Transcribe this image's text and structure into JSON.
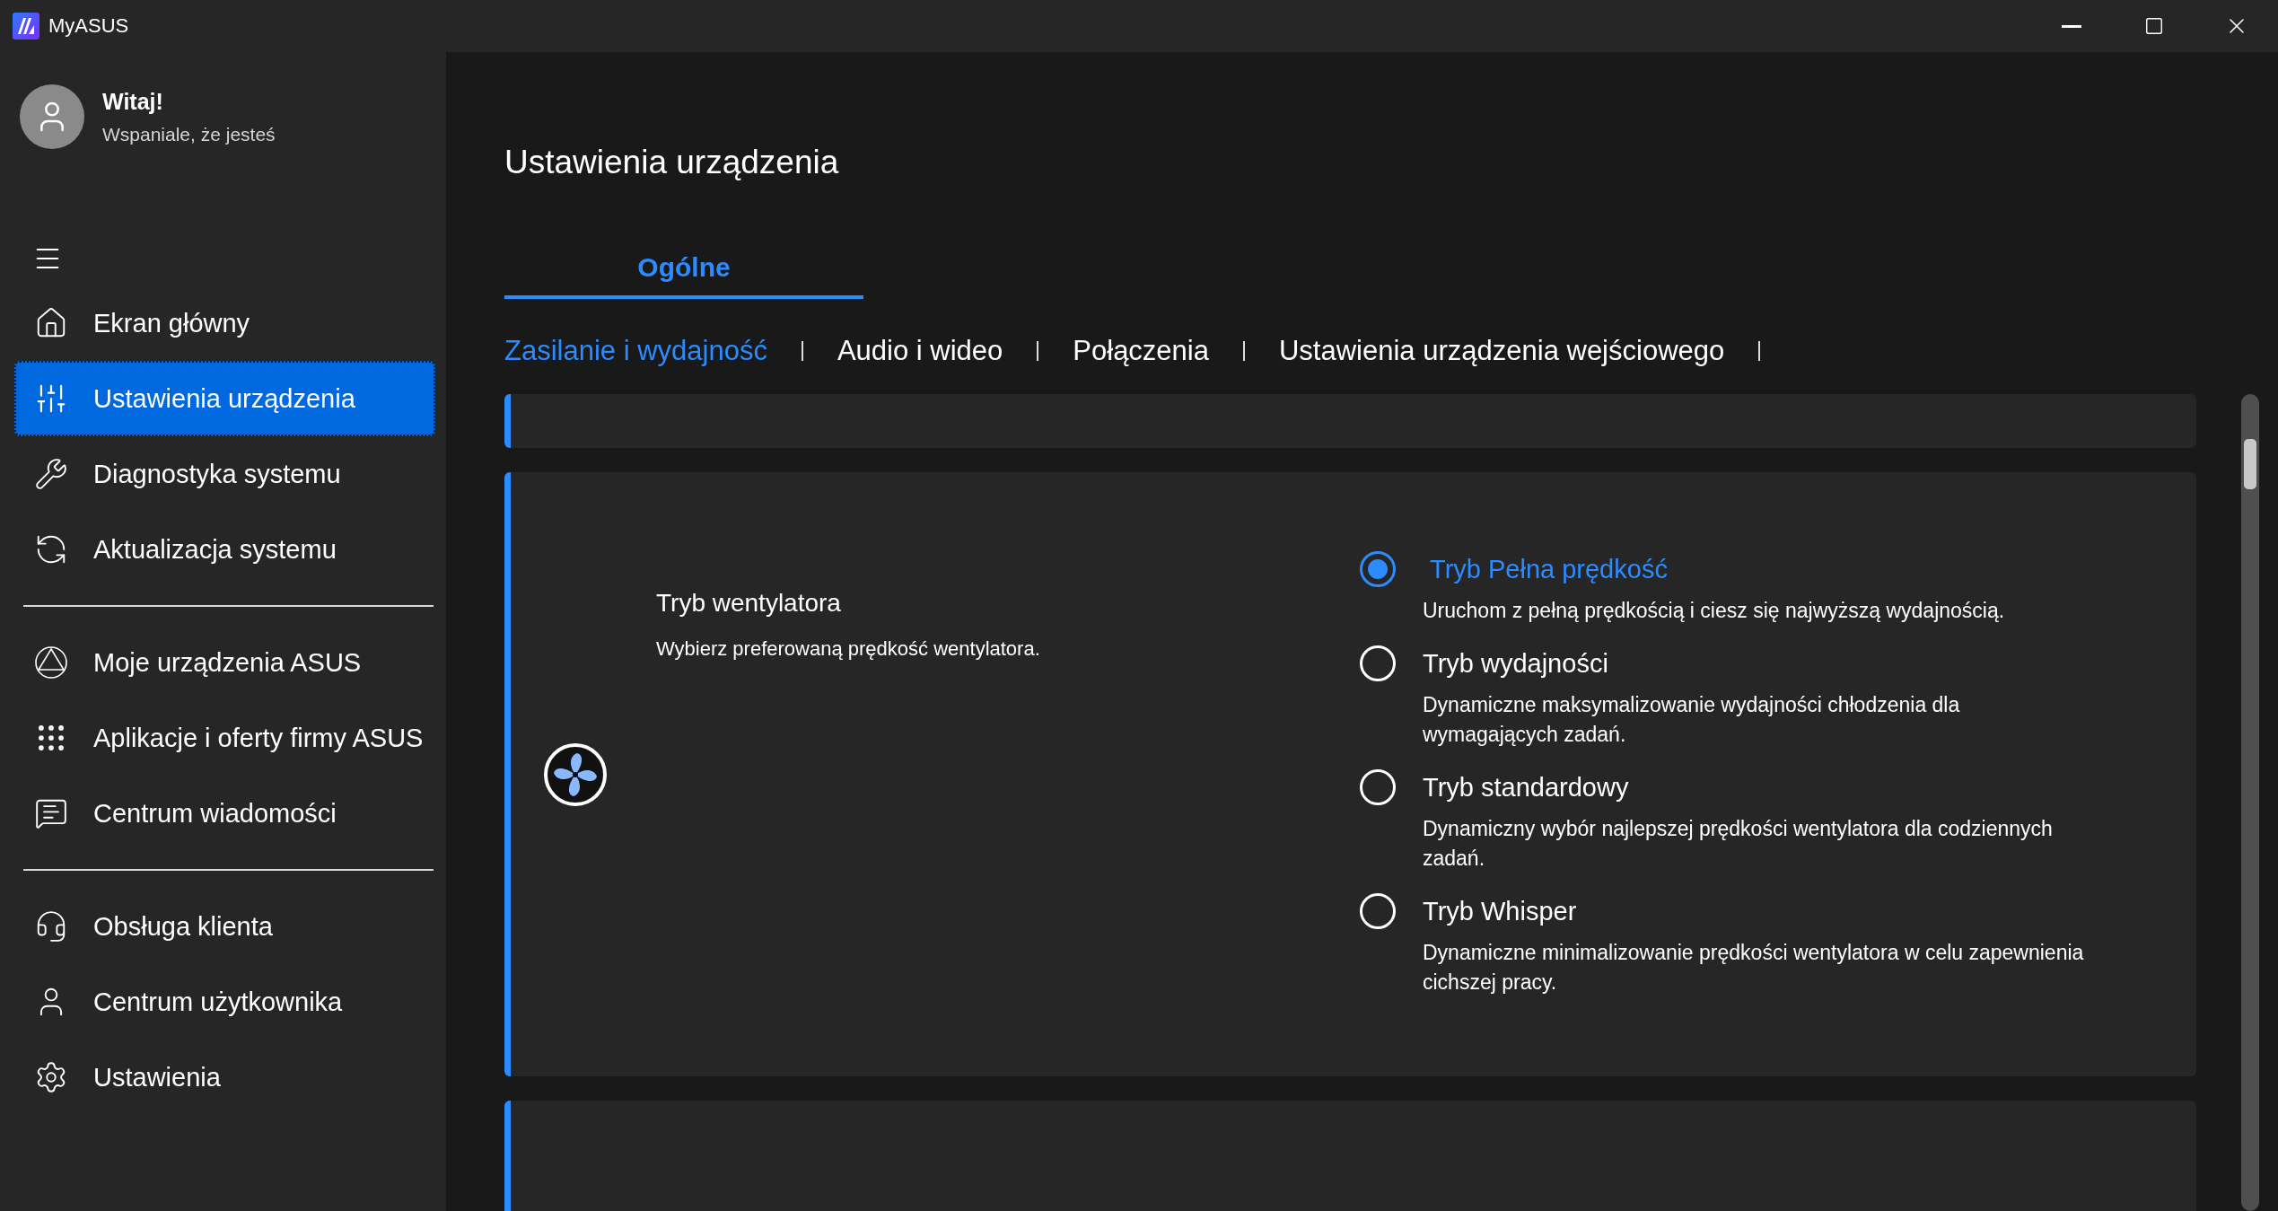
{
  "window": {
    "title": "MyASUS"
  },
  "profile": {
    "greeting": "Witaj!",
    "subtitle": "Wspaniale, że jesteś"
  },
  "sidebar": {
    "groups": [
      [
        {
          "label": "Ekran główny",
          "selected": false
        },
        {
          "label": "Ustawienia urządzenia",
          "selected": true
        },
        {
          "label": "Diagnostyka systemu",
          "selected": false
        },
        {
          "label": "Aktualizacja systemu",
          "selected": false
        }
      ],
      [
        {
          "label": "Moje urządzenia ASUS",
          "selected": false
        },
        {
          "label": "Aplikacje i oferty firmy ASUS",
          "selected": false
        },
        {
          "label": "Centrum wiadomości",
          "selected": false
        }
      ],
      [
        {
          "label": "Obsługa klienta",
          "selected": false
        },
        {
          "label": "Centrum użytkownika",
          "selected": false
        },
        {
          "label": "Ustawienia",
          "selected": false
        }
      ]
    ]
  },
  "page_title": "Ustawienia urządzenia",
  "tabs": [
    {
      "label": "Ogólne",
      "selected": true
    }
  ],
  "subtabs": [
    {
      "label": "Zasilanie i wydajność",
      "selected": true
    },
    {
      "label": "Audio i wideo",
      "selected": false
    },
    {
      "label": "Połączenia",
      "selected": false
    },
    {
      "label": "Ustawienia urządzenia wejściowego",
      "selected": false
    }
  ],
  "fan_card": {
    "title": "Tryb wentylatora",
    "subtitle": "Wybierz preferowaną prędkość wentylatora.",
    "options": [
      {
        "label": "Tryb Pełna prędkość",
        "description": "Uruchom z pełną prędkością i ciesz się najwyższą wydajnością.",
        "selected": true
      },
      {
        "label": "Tryb wydajności",
        "description": "Dynamiczne maksymalizowanie wydajności chłodzenia dla wymagających zadań.",
        "selected": false
      },
      {
        "label": "Tryb standardowy",
        "description": "Dynamiczny wybór najlepszej prędkości wentylatora dla codziennych zadań.",
        "selected": false
      },
      {
        "label": "Tryb Whisper",
        "description": "Dynamiczne minimalizowanie prędkości wentylatora w celu zapewnienia cichszej pracy.",
        "selected": false
      }
    ]
  }
}
